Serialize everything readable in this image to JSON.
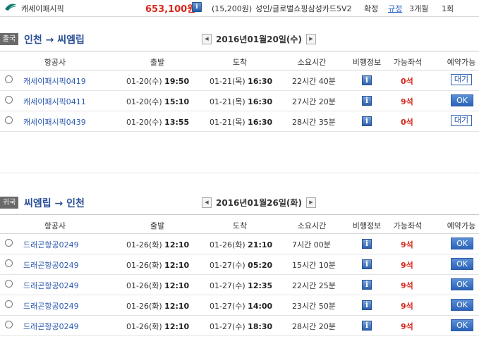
{
  "topbar": {
    "airline": "캐세이패시픽",
    "price": "653,100원",
    "info_icon": "i",
    "mileage": "(15,200원)",
    "card": "성인/글로벌쇼핑삼성카드5V2",
    "confirm": "확정",
    "rule": "규정",
    "months": "3개월",
    "count": "1회"
  },
  "outbound": {
    "tag": "출국",
    "route": "인천 → 씨엠립",
    "date": "2016년01월20일(수)",
    "prev": "◀",
    "next": "▶",
    "columns": [
      "항공사",
      "출발",
      "도착",
      "소요시간",
      "비행정보",
      "가능좌석",
      "예약가능"
    ],
    "rows": [
      {
        "flight": "캐세이패시픽0419",
        "dep_date": "01-20(수)",
        "dep_time": "19:50",
        "arr_date": "01-21(목)",
        "arr_time": "16:30",
        "duration": "22시간 40분",
        "seats": "0석",
        "action": "대기",
        "action_type": "wait"
      },
      {
        "flight": "캐세이패시픽0411",
        "dep_date": "01-20(수)",
        "dep_time": "15:10",
        "arr_date": "01-21(목)",
        "arr_time": "16:30",
        "duration": "27시간 20분",
        "seats": "9석",
        "action": "OK",
        "action_type": "ok"
      },
      {
        "flight": "캐세이패시픽0439",
        "dep_date": "01-20(수)",
        "dep_time": "13:55",
        "arr_date": "01-21(목)",
        "arr_time": "16:30",
        "duration": "28시간 35분",
        "seats": "0석",
        "action": "대기",
        "action_type": "wait"
      }
    ]
  },
  "inbound": {
    "tag": "귀국",
    "route": "씨엠립 → 인천",
    "date": "2016년01월26일(화)",
    "prev": "◀",
    "next": "▶",
    "columns": [
      "항공사",
      "출발",
      "도착",
      "소요시간",
      "비행정보",
      "가능좌석",
      "예약가능"
    ],
    "rows": [
      {
        "flight": "드래곤항공0249",
        "dep_date": "01-26(화)",
        "dep_time": "12:10",
        "arr_date": "01-26(화)",
        "arr_time": "21:10",
        "duration": "7시간 00분",
        "seats": "9석",
        "action": "OK",
        "action_type": "ok"
      },
      {
        "flight": "드래곤항공0249",
        "dep_date": "01-26(화)",
        "dep_time": "12:10",
        "arr_date": "01-27(수)",
        "arr_time": "05:20",
        "duration": "15시간 10분",
        "seats": "9석",
        "action": "OK",
        "action_type": "ok"
      },
      {
        "flight": "드래곤항공0249",
        "dep_date": "01-26(화)",
        "dep_time": "12:10",
        "arr_date": "01-27(수)",
        "arr_time": "12:35",
        "duration": "22시간 25분",
        "seats": "9석",
        "action": "OK",
        "action_type": "ok"
      },
      {
        "flight": "드래곤항공0249",
        "dep_date": "01-26(화)",
        "dep_time": "12:10",
        "arr_date": "01-27(수)",
        "arr_time": "14:00",
        "duration": "23시간 50분",
        "seats": "9석",
        "action": "OK",
        "action_type": "ok"
      },
      {
        "flight": "드래곤항공0249",
        "dep_date": "01-26(화)",
        "dep_time": "12:10",
        "arr_date": "01-27(수)",
        "arr_time": "18:30",
        "duration": "28시간 20분",
        "seats": "9석",
        "action": "OK",
        "action_type": "ok"
      }
    ]
  },
  "colors": {
    "accent_blue": "#2a4f96",
    "price_red": "#d6281c",
    "ok_button": "#2b63b8"
  }
}
